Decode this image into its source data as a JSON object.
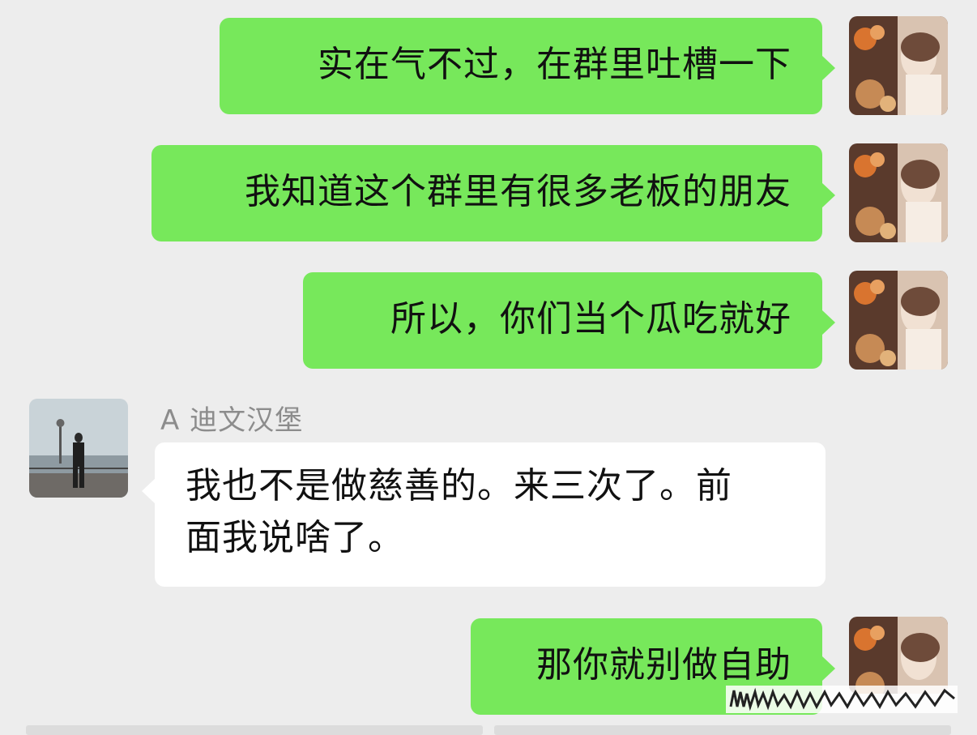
{
  "chat": {
    "messages": [
      {
        "sender": "self",
        "text": "实在气不过，在群里吐槽一下"
      },
      {
        "sender": "self",
        "text": "我知道这个群里有很多老板的朋友"
      },
      {
        "sender": "self",
        "text": "所以，你们当个瓜吃就好"
      },
      {
        "sender": "other",
        "sender_name": "A 迪文汉堡",
        "lines": [
          "我也不是做慈善的。来三次了。前",
          "面我说啥了。"
        ]
      },
      {
        "sender": "self",
        "text": "那你就别做自助"
      }
    ]
  },
  "colors": {
    "background": "#ededed",
    "self_bubble": "#77e85b",
    "other_bubble": "#ffffff",
    "name_text": "#8c8c8c"
  },
  "icons": {
    "self_avatar": "avatar-photo-woman-flowers",
    "other_avatar": "avatar-photo-man-waterfront",
    "watermark": "watermark-scribble"
  }
}
